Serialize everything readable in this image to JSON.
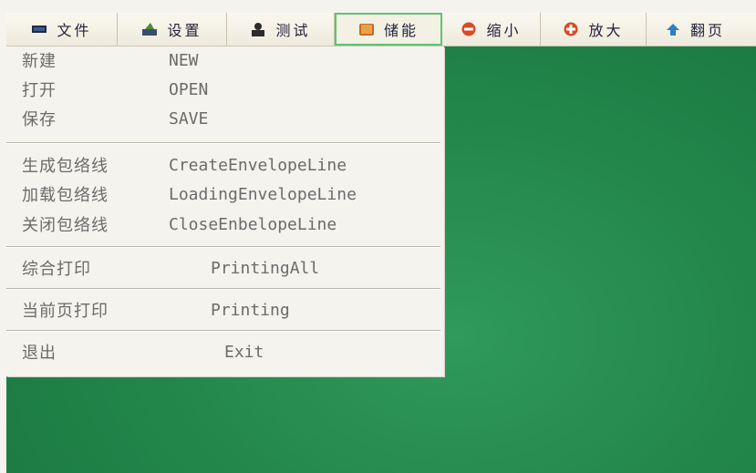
{
  "toolbar": {
    "buttons": [
      {
        "label": "文件",
        "icon": "monitor-icon"
      },
      {
        "label": "设置",
        "icon": "settings-icon"
      },
      {
        "label": "测试",
        "icon": "test-icon"
      },
      {
        "label": "储能",
        "icon": "book-icon"
      },
      {
        "label": "缩小",
        "icon": "minus-circle-icon"
      },
      {
        "label": "放大",
        "icon": "plus-circle-icon"
      },
      {
        "label": "翻页",
        "icon": "page-turn-icon"
      }
    ],
    "active_button": "储能",
    "colors": {
      "minus": "#d94a26",
      "plus": "#d94a26",
      "active_border": "#5fc470"
    }
  },
  "file_menu": {
    "items": [
      {
        "zh": "新建",
        "en": "NEW"
      },
      {
        "zh": "打开",
        "en": "OPEN"
      },
      {
        "zh": "保存",
        "en": "SAVE"
      },
      {
        "zh": "生成包络线",
        "en": "CreateEnvelopeLine"
      },
      {
        "zh": "加载包络线",
        "en": "LoadingEnvelopeLine"
      },
      {
        "zh": "关闭包络线",
        "en": "CloseEnbelopeLine"
      },
      {
        "zh": "综合打印",
        "en": "PrintingAll"
      },
      {
        "zh": "当前页打印",
        "en": "Printing"
      },
      {
        "zh": "退出",
        "en": "Exit"
      }
    ]
  },
  "colors": {
    "screen_green": "#23874b",
    "menu_bg": "#f5f3ee"
  }
}
